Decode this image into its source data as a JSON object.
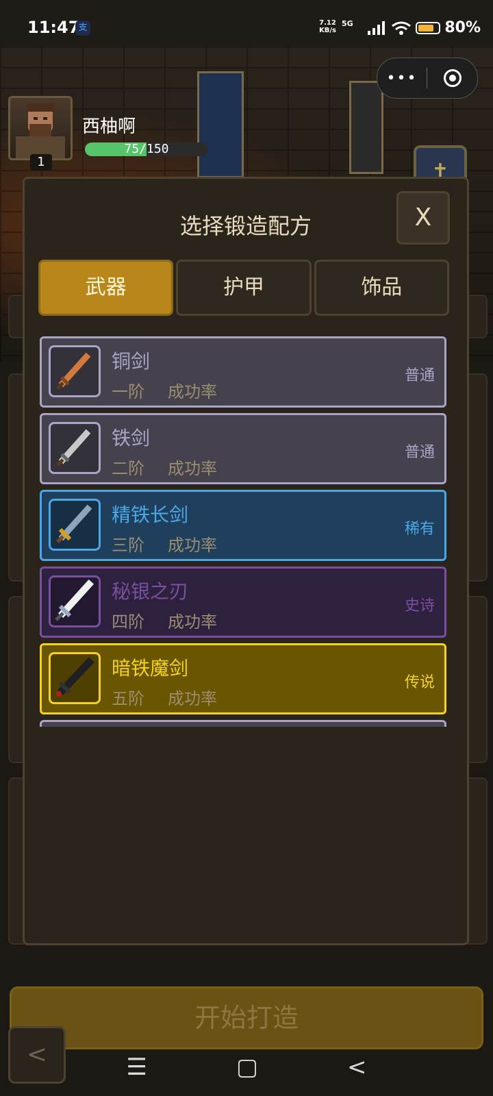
{
  "status_bar": {
    "time": "11:47",
    "app_icon_glyph": "支",
    "net_speed_value": "7.12",
    "net_speed_unit": "KB/s",
    "network": "5G",
    "battery_level": 0.8,
    "battery_text": "80%"
  },
  "capsule": {
    "more_glyph": "•••"
  },
  "player": {
    "name": "西柚啊",
    "level": "1",
    "hp_current": 75,
    "hp_max": 150,
    "hp_text": "75/150"
  },
  "modal": {
    "title": "选择锻造配方",
    "close_label": "X",
    "tabs": [
      {
        "label": "武器"
      },
      {
        "label": "护甲"
      },
      {
        "label": "饰品"
      }
    ],
    "recipes": [
      {
        "name": "铜剑",
        "tier": "一阶",
        "rate_label": "成功率",
        "rarity": "普通",
        "color": "#a9a4c8",
        "bg": "#45424e",
        "icon": "copper-sword-icon"
      },
      {
        "name": "铁剑",
        "tier": "二阶",
        "rate_label": "成功率",
        "rarity": "普通",
        "color": "#a9a4c8",
        "bg": "#45424e",
        "icon": "iron-sword-icon"
      },
      {
        "name": "精铁长剑",
        "tier": "三阶",
        "rate_label": "成功率",
        "rarity": "稀有",
        "color": "#4aa8e8",
        "bg": "#1f3f5c",
        "icon": "fine-iron-longsword-icon"
      },
      {
        "name": "秘银之刃",
        "tier": "四阶",
        "rate_label": "成功率",
        "rarity": "史诗",
        "color": "#7a4f9e",
        "bg": "#2e2140",
        "icon": "mithril-blade-icon"
      },
      {
        "name": "暗铁魔剑",
        "tier": "五阶",
        "rate_label": "成功率",
        "rarity": "传说",
        "color": "#f5d21f",
        "bg": "#6b5600",
        "icon": "dark-iron-demon-sword-icon"
      }
    ]
  },
  "forge_button": {
    "label": "开始打造"
  },
  "back_button": {
    "label": "<"
  },
  "nav": {
    "menu": "☰",
    "home": "▢",
    "back": "<"
  }
}
